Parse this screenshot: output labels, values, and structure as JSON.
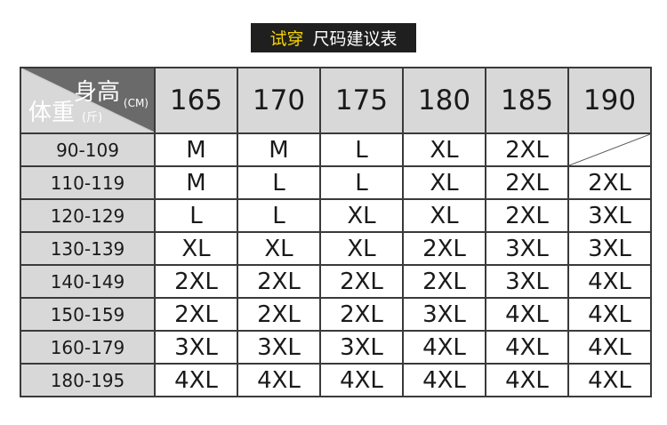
{
  "title": {
    "accent": "试穿",
    "rest": "尺码建议表"
  },
  "corner": {
    "height_label": "身高",
    "height_unit": "(CM)",
    "weight_label": "体重",
    "weight_unit": "(斤)"
  },
  "heights": [
    "165",
    "170",
    "175",
    "180",
    "185",
    "190"
  ],
  "rows": [
    {
      "weight": "90-109",
      "sizes": [
        "M",
        "M",
        "L",
        "XL",
        "2XL",
        ""
      ]
    },
    {
      "weight": "110-119",
      "sizes": [
        "M",
        "L",
        "L",
        "XL",
        "2XL",
        "2XL"
      ]
    },
    {
      "weight": "120-129",
      "sizes": [
        "L",
        "L",
        "XL",
        "XL",
        "2XL",
        "3XL"
      ]
    },
    {
      "weight": "130-139",
      "sizes": [
        "XL",
        "XL",
        "XL",
        "2XL",
        "3XL",
        "3XL"
      ]
    },
    {
      "weight": "140-149",
      "sizes": [
        "2XL",
        "2XL",
        "2XL",
        "2XL",
        "3XL",
        "4XL"
      ]
    },
    {
      "weight": "150-159",
      "sizes": [
        "2XL",
        "2XL",
        "2XL",
        "3XL",
        "4XL",
        "4XL"
      ]
    },
    {
      "weight": "160-179",
      "sizes": [
        "3XL",
        "3XL",
        "3XL",
        "4XL",
        "4XL",
        "4XL"
      ]
    },
    {
      "weight": "180-195",
      "sizes": [
        "4XL",
        "4XL",
        "4XL",
        "4XL",
        "4XL",
        "4XL"
      ]
    }
  ],
  "colors": {
    "banner_bg": "#1f1f1f",
    "banner_accent": "#f5d400",
    "header_bg": "#d8d8d8",
    "corner_bg": "#555555",
    "border": "#3a3a3a"
  }
}
